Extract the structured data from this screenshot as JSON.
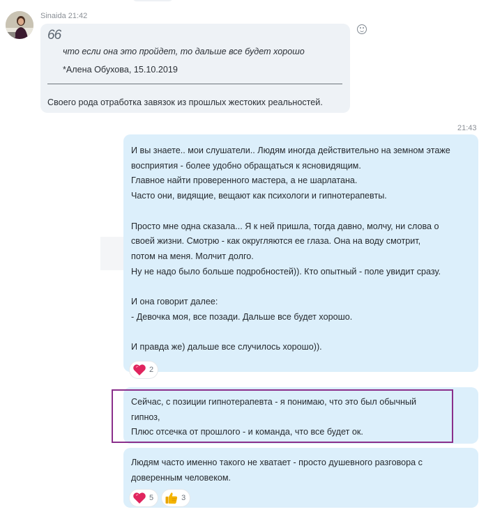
{
  "incoming": {
    "sender": "Sinaida",
    "time": "21:42",
    "quote": {
      "mark": "66",
      "text": "что если она это пройдет, то дальше все будет хорошо",
      "author": "*Алена Обухова, 15.10.2019"
    },
    "reply": "Своего рода отработка завязок из прошлых жестоких реальностей."
  },
  "outgoing": {
    "time": "21:43",
    "message1": {
      "lines": [
        "И вы знаете.. мои слушатели.. Людям иногда действительно на земном этаже",
        "восприятия - более удобно обращаться к ясновидящим.",
        "Главное найти проверенного мастера, а не шарлатана.",
        "Часто они, видящие, вещают как психологи и гипнотерапевты.",
        "",
        "Просто мне одна сказала... Я к ней пришла, тогда давно, молчу, ни слова о",
        "своей жизни. Смотрю - как округляются ее глаза. Она на воду смотрит,",
        "потом на меня. Молчит долго.",
        "Ну не надо было больше подробностей)). Кто опытный - поле увидит сразу.",
        "",
        "И она говорит далее:",
        "- Девочка моя, все позади. Дальше все будет хорошо.",
        "",
        "И правда же) дальше все случилось хорошо))."
      ],
      "reactions": [
        {
          "icon": "heart-icon",
          "count": "2"
        }
      ]
    },
    "message2": {
      "lines": [
        "Сейчас, с позиции гипнотерапевта - я понимаю, что это был обычный",
        "гипноз,",
        "Плюс отсечка от прошлого - и команда, что все будет ок."
      ]
    },
    "message3": {
      "lines": [
        "Людям часто именно такого не хватает - просто душевного разговора с",
        "доверенным человеком."
      ],
      "reactions": [
        {
          "icon": "heart-icon",
          "count": "5"
        },
        {
          "icon": "thumbs-up-icon",
          "count": "3"
        }
      ]
    }
  },
  "colors": {
    "incoming_bubble": "#eef2f6",
    "outgoing_bubble": "#dceffb",
    "highlight_border": "#8a2f8b",
    "heart": "#e0245e",
    "thumb": "#f4b400"
  }
}
